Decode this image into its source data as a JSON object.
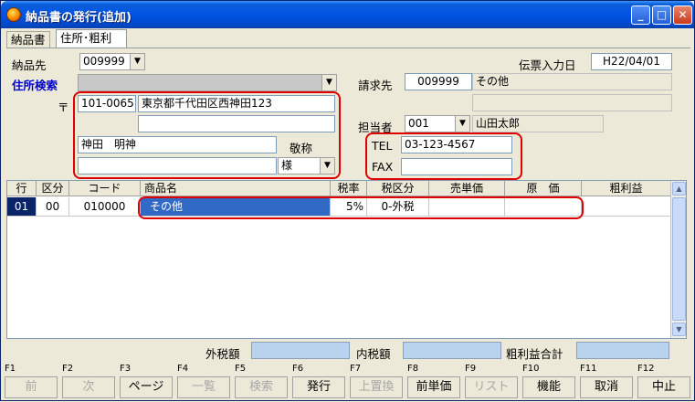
{
  "window": {
    "title": "納品書の発行(追加)",
    "minimize": "_",
    "maximize": "□",
    "close": "✕"
  },
  "tabs": [
    {
      "label": "納品書"
    },
    {
      "label": "住所･粗利"
    }
  ],
  "form": {
    "delivery_to_label": "納品先",
    "delivery_to_value": "009999",
    "slip_date_label": "伝票入力日",
    "slip_date_value": "H22/04/01",
    "address_search_label": "住所検索",
    "address_search_value": "",
    "billing_label": "請求先",
    "billing_code": "009999",
    "billing_name": "その他",
    "billing_name2": "",
    "postal_symbol": "〒",
    "postal_code": "101-0065",
    "address1": "東京都千代田区西神田123",
    "address2": "",
    "contact_label": "担当者",
    "contact_code": "001",
    "contact_name": "山田太郎",
    "person_name": "神田　明神",
    "honorific_label": "敬称",
    "honorific_value": "様",
    "extra_line": "",
    "tel_label": "TEL",
    "tel_value": "03-123-4567",
    "fax_label": "FAX",
    "fax_value": ""
  },
  "grid": {
    "headers": [
      "行",
      "区分",
      "コード",
      "商品名",
      "税率",
      "税区分",
      "売単価",
      "原　価",
      "粗利益"
    ],
    "rows": [
      {
        "line": "01",
        "category": "00",
        "code": "010000",
        "product": "その他",
        "tax_rate": "5%",
        "tax_class": "0-外税",
        "unit_price": "",
        "cost": "",
        "gross_profit": ""
      }
    ]
  },
  "totals": {
    "outer_tax_label": "外税額",
    "outer_tax_value": "",
    "inner_tax_label": "内税額",
    "inner_tax_value": "",
    "gross_total_label": "粗利益合計",
    "gross_total_value": ""
  },
  "fkeys": [
    {
      "key": "F1",
      "label": "前",
      "enabled": false
    },
    {
      "key": "F2",
      "label": "次",
      "enabled": false
    },
    {
      "key": "F3",
      "label": "ページ",
      "enabled": true
    },
    {
      "key": "F4",
      "label": "一覧",
      "enabled": false
    },
    {
      "key": "F5",
      "label": "検索",
      "enabled": false
    },
    {
      "key": "F6",
      "label": "発行",
      "enabled": true
    },
    {
      "key": "F7",
      "label": "上置換",
      "enabled": false
    },
    {
      "key": "F8",
      "label": "前単価",
      "enabled": true
    },
    {
      "key": "F9",
      "label": "リスト",
      "enabled": false
    },
    {
      "key": "F10",
      "label": "機能",
      "enabled": true
    },
    {
      "key": "F11",
      "label": "取消",
      "enabled": true
    },
    {
      "key": "F12",
      "label": "中止",
      "enabled": true
    }
  ],
  "colors": {
    "titlebar": "#0054e3",
    "highlight": "#e00000",
    "selection": "#316ac5",
    "label_blue": "#0000c8",
    "total_field": "#b9d3ee"
  }
}
